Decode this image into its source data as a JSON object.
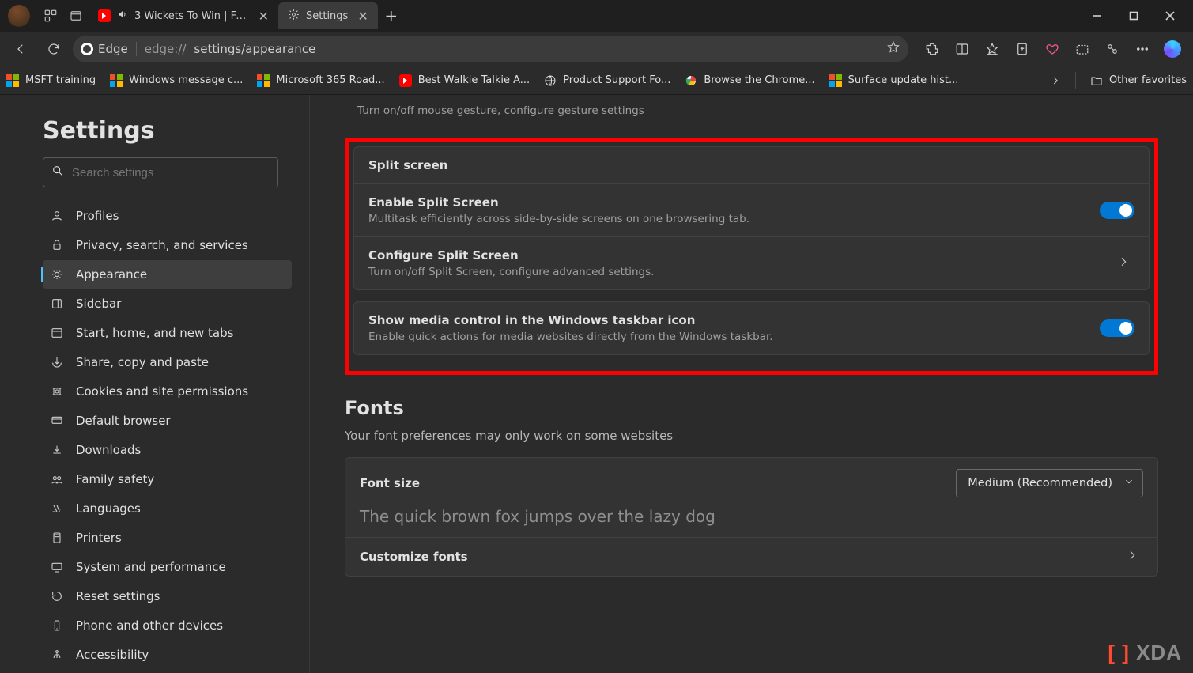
{
  "window": {
    "tabs": [
      {
        "title": "3 Wickets To Win | Final ...",
        "active": false,
        "icon": "youtube"
      },
      {
        "title": "Settings",
        "active": true,
        "icon": "gear"
      }
    ],
    "newtab": "+"
  },
  "toolbar": {
    "edge_label": "Edge",
    "url_prefix": "edge://",
    "url_path": "settings/appearance"
  },
  "bookmarks": {
    "items": [
      {
        "label": "MSFT training",
        "icon": "ms"
      },
      {
        "label": "Windows message c...",
        "icon": "ms"
      },
      {
        "label": "Microsoft 365 Road...",
        "icon": "ms"
      },
      {
        "label": "Best Walkie Talkie A...",
        "icon": "yt"
      },
      {
        "label": "Product Support Fo...",
        "icon": "globe"
      },
      {
        "label": "Browse the Chrome...",
        "icon": "chrome"
      },
      {
        "label": "Surface update hist...",
        "icon": "ms"
      }
    ],
    "other": "Other favorites"
  },
  "sidebar": {
    "title": "Settings",
    "search_placeholder": "Search settings",
    "items": [
      {
        "label": "Profiles"
      },
      {
        "label": "Privacy, search, and services"
      },
      {
        "label": "Appearance",
        "active": true
      },
      {
        "label": "Sidebar"
      },
      {
        "label": "Start, home, and new tabs"
      },
      {
        "label": "Share, copy and paste"
      },
      {
        "label": "Cookies and site permissions"
      },
      {
        "label": "Default browser"
      },
      {
        "label": "Downloads"
      },
      {
        "label": "Family safety"
      },
      {
        "label": "Languages"
      },
      {
        "label": "Printers"
      },
      {
        "label": "System and performance"
      },
      {
        "label": "Reset settings"
      },
      {
        "label": "Phone and other devices"
      },
      {
        "label": "Accessibility"
      }
    ]
  },
  "main": {
    "gesture_desc": "Turn on/off mouse gesture, configure gesture settings",
    "split_screen": {
      "header": "Split screen",
      "enable_title": "Enable Split Screen",
      "enable_desc": "Multitask efficiently across side-by-side screens on one browsering tab.",
      "configure_title": "Configure Split Screen",
      "configure_desc": "Turn on/off Split Screen, configure advanced settings."
    },
    "media": {
      "title": "Show media control in the Windows taskbar icon",
      "desc": "Enable quick actions for media websites directly from the Windows taskbar."
    },
    "fonts": {
      "heading": "Fonts",
      "hint": "Your font preferences may only work on some websites",
      "size_label": "Font size",
      "size_value": "Medium (Recommended)",
      "preview": "The quick brown fox jumps over the lazy dog",
      "customize": "Customize fonts"
    }
  },
  "watermark": {
    "brackets": "[ ]",
    "text": "XDA"
  }
}
